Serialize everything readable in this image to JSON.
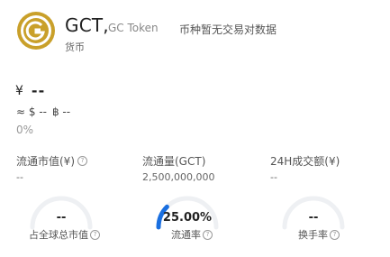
{
  "coin": {
    "symbol": "GCT,",
    "full_name": "GC Token",
    "no_trade_notice": "币种暂无交易对数据",
    "type_label": "货币",
    "logo_icon": "gct-coin-logo"
  },
  "price": {
    "currency_symbol": "¥",
    "value": "--",
    "usd_approx": "≈ $ --",
    "btc": "฿ --",
    "change": "0%"
  },
  "stats": [
    {
      "label": "流通市值(¥)",
      "value": "--"
    },
    {
      "label": "流通量(GCT)",
      "value": "2,500,000,000"
    },
    {
      "label": "24H成交额(¥)",
      "value": "--"
    }
  ],
  "gauges": [
    {
      "label": "占全球总市值",
      "display": "--",
      "fraction": 0
    },
    {
      "label": "流通率",
      "display": "25.00%",
      "fraction": 0.25
    },
    {
      "label": "换手率",
      "display": "--",
      "fraction": 0
    }
  ],
  "colors": {
    "accent": "#1a6fe0",
    "track": "#eef0f3",
    "logo_gold": "#c9a02a"
  }
}
